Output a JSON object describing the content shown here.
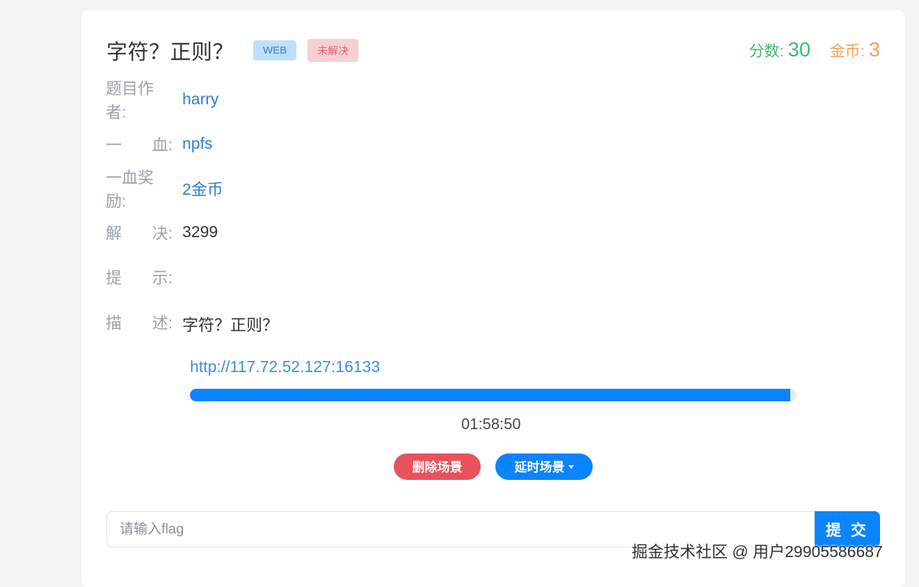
{
  "challenge": {
    "title": "字符？正则？",
    "category_badge": "WEB",
    "status_badge": "未解决",
    "score_label": "分数:",
    "score_value": "30",
    "gold_label": "金币:",
    "gold_value": "3"
  },
  "info": {
    "author_label": "题目作者:",
    "author": "harry",
    "first_blood_label_a": "一",
    "first_blood_label_b": "血:",
    "first_blood": "npfs",
    "first_blood_reward_label": "一血奖励:",
    "first_blood_reward": "2金币",
    "solved_label_a": "解",
    "solved_label_b": "决:",
    "solved": "3299",
    "hint_label_a": "提",
    "hint_label_b": "示:",
    "hint": "",
    "desc_label_a": "描",
    "desc_label_b": "述:",
    "desc": "字符？正则？"
  },
  "scene": {
    "url": "http://117.72.52.127:16133",
    "progress_percent": 99,
    "timer": "01:58:50",
    "delete_label": "删除场景",
    "delay_label": "延时场景"
  },
  "flag": {
    "placeholder": "请输入flag",
    "submit_label": "提 交"
  },
  "watermark": "掘金技术社区 @ 用户2990558668​7",
  "colors": {
    "primary": "#0b84fe",
    "score": "#3cba6f",
    "gold": "#f3a14b",
    "danger": "#e8525c"
  }
}
